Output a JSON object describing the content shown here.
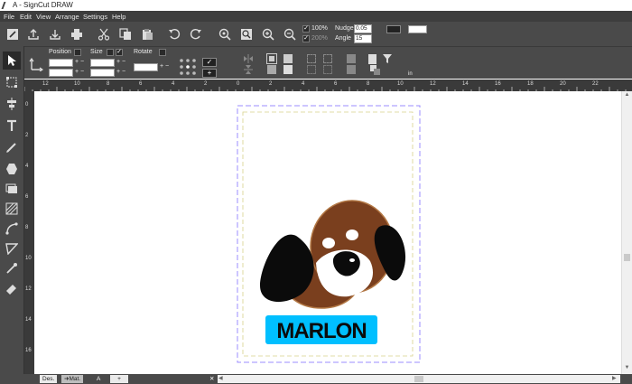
{
  "window": {
    "title": "A - SignCut DRAW"
  },
  "menu": [
    "File",
    "Edit",
    "View",
    "Arrange",
    "Settings",
    "Help"
  ],
  "toolbar": {
    "zoom_lock_label": "100%",
    "zoom_lock2_label": "200%",
    "nudge_label": "Nudge",
    "nudge_value": "0.05",
    "angle_label": "Angle",
    "angle_value": "15"
  },
  "props": {
    "position_label": "Position",
    "size_label": "Size",
    "rotate_label": "Rotate",
    "unit_label": "in"
  },
  "ruler": {
    "top": [
      "12",
      "10",
      "8",
      "6",
      "4",
      "2",
      "0",
      "2",
      "4",
      "6",
      "8",
      "10",
      "12",
      "14",
      "16",
      "18",
      "20",
      "22"
    ],
    "left": [
      "0",
      "2",
      "4",
      "6",
      "8",
      "10",
      "12",
      "14",
      "16",
      "18"
    ]
  },
  "design": {
    "name_text": "MARLON",
    "tag_color": "#00bfff",
    "dog_brown": "#7a3f1e",
    "dog_black": "#0b0b0b"
  },
  "tabs": [
    "Des.",
    "Mat.",
    "A",
    "+"
  ],
  "colors": {
    "accent": "#9b8cff"
  }
}
